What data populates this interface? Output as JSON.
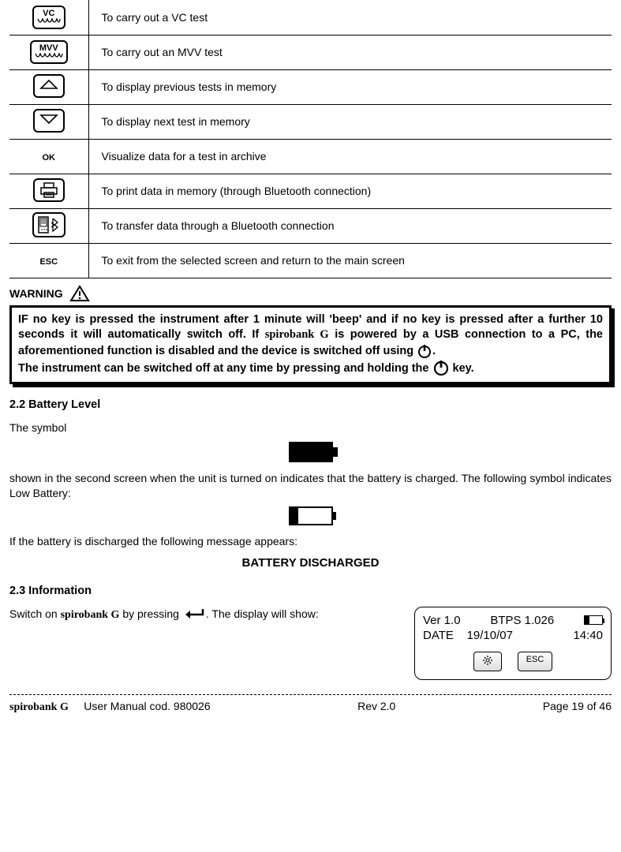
{
  "table": {
    "rows": [
      {
        "icon": "vc",
        "label": "VC",
        "desc": "To carry out a VC test"
      },
      {
        "icon": "mvv",
        "label": "MVV",
        "desc": "To carry out an MVV test"
      },
      {
        "icon": "up",
        "desc": "To display previous tests in memory"
      },
      {
        "icon": "down",
        "desc": "To display next test in memory"
      },
      {
        "icon": "ok",
        "label": "OK",
        "desc": "Visualize data for a test in archive"
      },
      {
        "icon": "print",
        "desc": "To print data in memory (through Bluetooth connection)"
      },
      {
        "icon": "bt",
        "desc": "To transfer data through a Bluetooth connection"
      },
      {
        "icon": "esc",
        "label": "ESC",
        "desc": "To exit from the selected screen and return to the main screen"
      }
    ]
  },
  "warning": {
    "label": "WARNING",
    "text_pre": "IF no key is pressed the instrument after 1 minute will 'beep' and if no key is pressed after a further 10 seconds it will automatically switch off. If ",
    "brand": "spirobank G",
    "text_mid": " is powered by a USB connection to a PC, the aforementioned function is disabled and the device is switched off using ",
    "text_end": ".",
    "line2_pre": "The instrument can be switched off at any time by pressing and holding the ",
    "line2_end": " key."
  },
  "sections": {
    "s22_title": "2.2  Battery Level",
    "s22_p1": "The symbol",
    "s22_p2": "shown in the second screen when the unit is turned on indicates that the battery is charged. The following symbol indicates Low Battery:",
    "s22_p3": "If the battery is discharged the following message appears:",
    "s22_msg": "BATTERY DISCHARGED",
    "s23_title": "2.3  Information",
    "s23_p1_pre": "Switch on ",
    "s23_brand": "spirobank G",
    "s23_p1_mid": " by pressing ",
    "s23_p1_end": ". The display will show:"
  },
  "lcd": {
    "ver": "Ver  1.0",
    "btps": "BTPS 1.026",
    "date_label": "DATE",
    "date_val": "19/10/07",
    "time": "14:40",
    "btn_gear": "⚙",
    "btn_esc": "ESC"
  },
  "footer": {
    "product": "spirobank G",
    "manual": "User Manual cod. 980026",
    "rev": "Rev 2.0",
    "page": "Page 19 of 46"
  }
}
